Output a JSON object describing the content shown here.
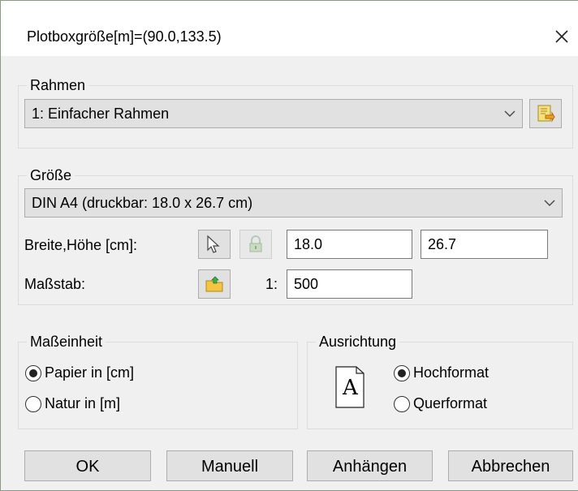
{
  "title": "Plotboxgröße[m]=(90.0,133.5)",
  "frame": {
    "legend": "Rahmen",
    "selected": "1: Einfacher Rahmen"
  },
  "size": {
    "legend": "Größe",
    "paper": "DIN A4 (druckbar: 18.0 x 26.7 cm)",
    "dims_label": "Breite,Höhe [cm]:",
    "width": "18.0",
    "height": "26.7",
    "scale_label": "Maßstab:",
    "scale_prefix": "1:",
    "scale_value": "500"
  },
  "units": {
    "legend": "Maßeinheit",
    "option_paper": "Papier in [cm]",
    "option_nature": "Natur in [m]",
    "selected": "paper"
  },
  "orientation": {
    "legend": "Ausrichtung",
    "option_portrait": "Hochformat",
    "option_landscape": "Querformat",
    "selected": "portrait",
    "preview_letter": "A"
  },
  "buttons": {
    "ok": "OK",
    "manual": "Manuell",
    "append": "Anhängen",
    "cancel": "Abbrechen"
  }
}
